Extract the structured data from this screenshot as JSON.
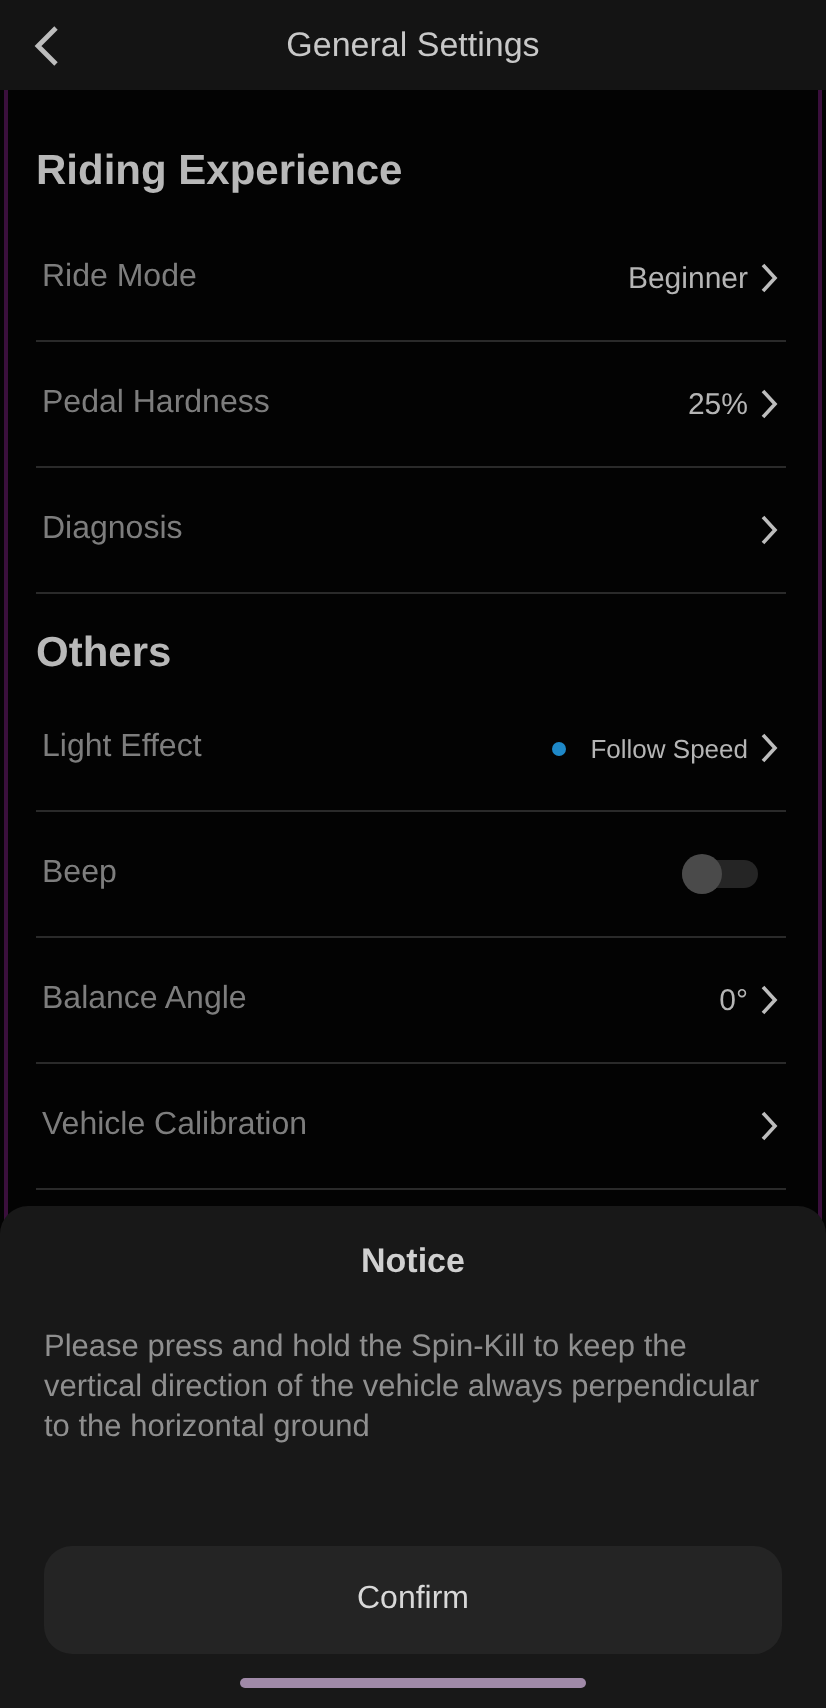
{
  "header": {
    "title": "General Settings"
  },
  "sections": [
    {
      "title": "Riding Experience",
      "items": [
        {
          "kind": "link",
          "label": "Ride Mode",
          "value": "Beginner"
        },
        {
          "kind": "link",
          "label": "Pedal Hardness",
          "value": "25%"
        },
        {
          "kind": "link",
          "label": "Diagnosis"
        }
      ]
    },
    {
      "title": "Others",
      "items": [
        {
          "kind": "link",
          "label": "Light Effect",
          "value": "Follow Speed",
          "color": "#1e88c8"
        },
        {
          "kind": "toggle",
          "label": "Beep",
          "on": false
        },
        {
          "kind": "link",
          "label": "Balance Angle",
          "value": "0°"
        },
        {
          "kind": "link",
          "label": "Vehicle Calibration"
        }
      ]
    }
  ],
  "sheet": {
    "title": "Notice",
    "message": "Please press and hold the Spin-Kill to keep the vertical direction of the vehicle always perpendicular to the horizontal ground",
    "button": "Confirm"
  }
}
